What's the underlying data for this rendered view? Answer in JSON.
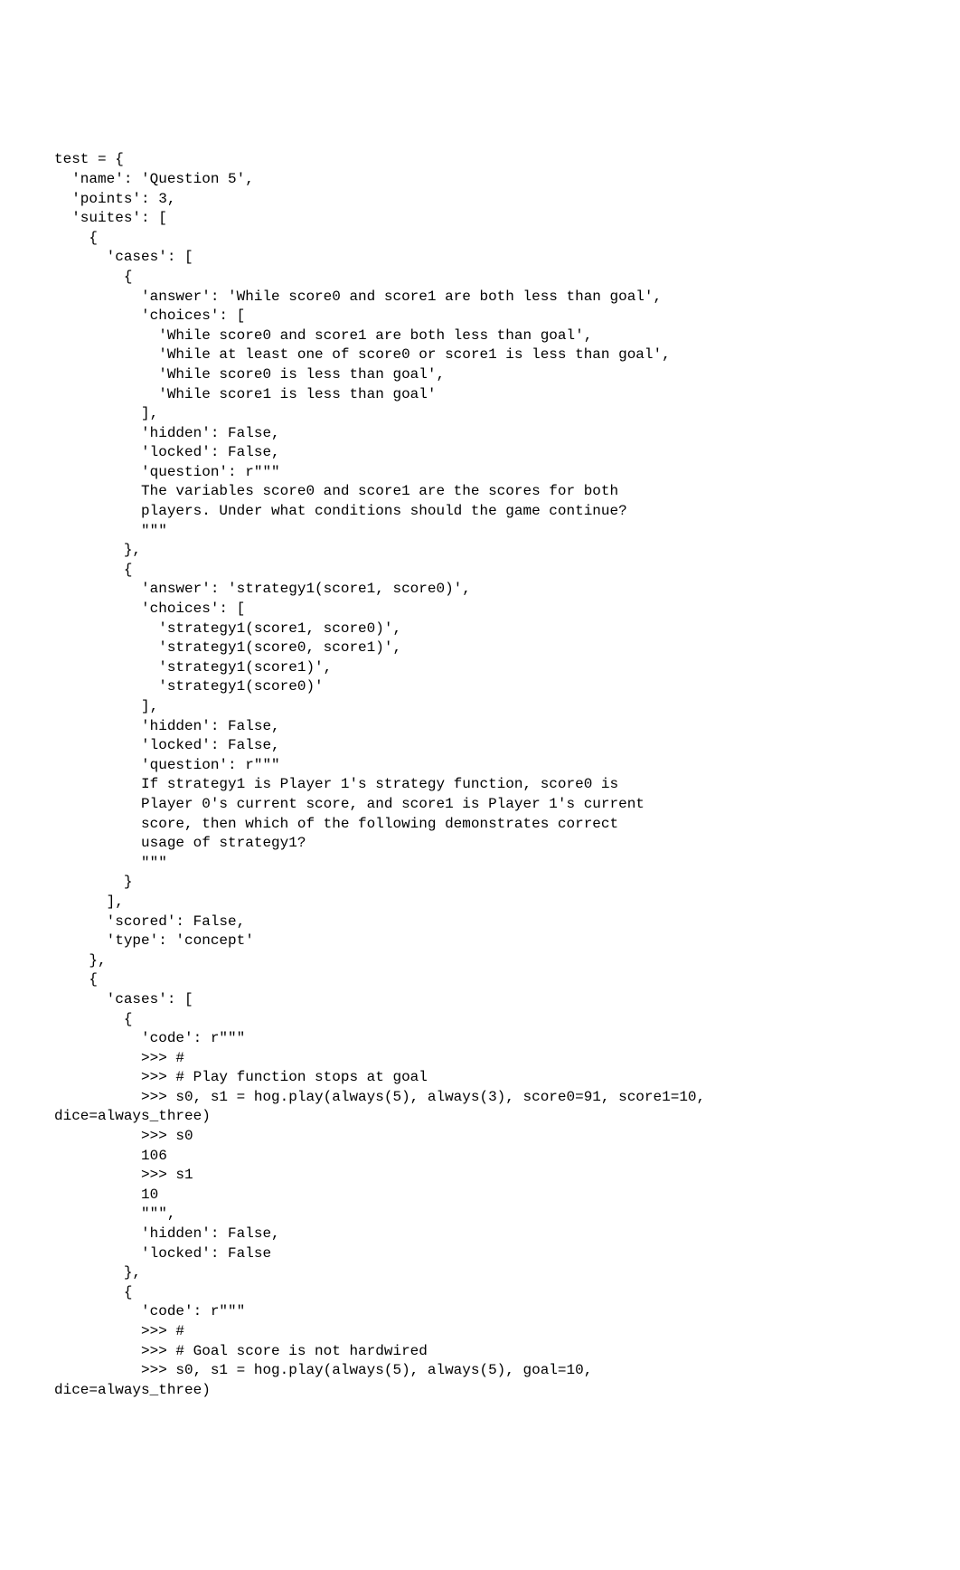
{
  "lines": [
    "test = {",
    "  'name': 'Question 5',",
    "  'points': 3,",
    "  'suites': [",
    "    {",
    "      'cases': [",
    "        {",
    "          'answer': 'While score0 and score1 are both less than goal',",
    "          'choices': [",
    "            'While score0 and score1 are both less than goal',",
    "            'While at least one of score0 or score1 is less than goal',",
    "            'While score0 is less than goal',",
    "            'While score1 is less than goal'",
    "          ],",
    "          'hidden': False,",
    "          'locked': False,",
    "          'question': r\"\"\"",
    "          The variables score0 and score1 are the scores for both",
    "          players. Under what conditions should the game continue?",
    "          \"\"\"",
    "        },",
    "        {",
    "          'answer': 'strategy1(score1, score0)',",
    "          'choices': [",
    "            'strategy1(score1, score0)',",
    "            'strategy1(score0, score1)',",
    "            'strategy1(score1)',",
    "            'strategy1(score0)'",
    "          ],",
    "          'hidden': False,",
    "          'locked': False,",
    "          'question': r\"\"\"",
    "          If strategy1 is Player 1's strategy function, score0 is",
    "          Player 0's current score, and score1 is Player 1's current",
    "          score, then which of the following demonstrates correct",
    "          usage of strategy1?",
    "          \"\"\"",
    "        }",
    "      ],",
    "      'scored': False,",
    "      'type': 'concept'",
    "    },",
    "    {",
    "      'cases': [",
    "        {",
    "          'code': r\"\"\"",
    "          >>> #",
    "          >>> # Play function stops at goal",
    "          >>> s0, s1 = hog.play(always(5), always(3), score0=91, score1=10,",
    "dice=always_three)",
    "          >>> s0",
    "          106",
    "          >>> s1",
    "          10",
    "          \"\"\",",
    "          'hidden': False,",
    "          'locked': False",
    "        },",
    "        {",
    "          'code': r\"\"\"",
    "          >>> #",
    "          >>> # Goal score is not hardwired",
    "          >>> s0, s1 = hog.play(always(5), always(5), goal=10,",
    "dice=always_three)"
  ]
}
